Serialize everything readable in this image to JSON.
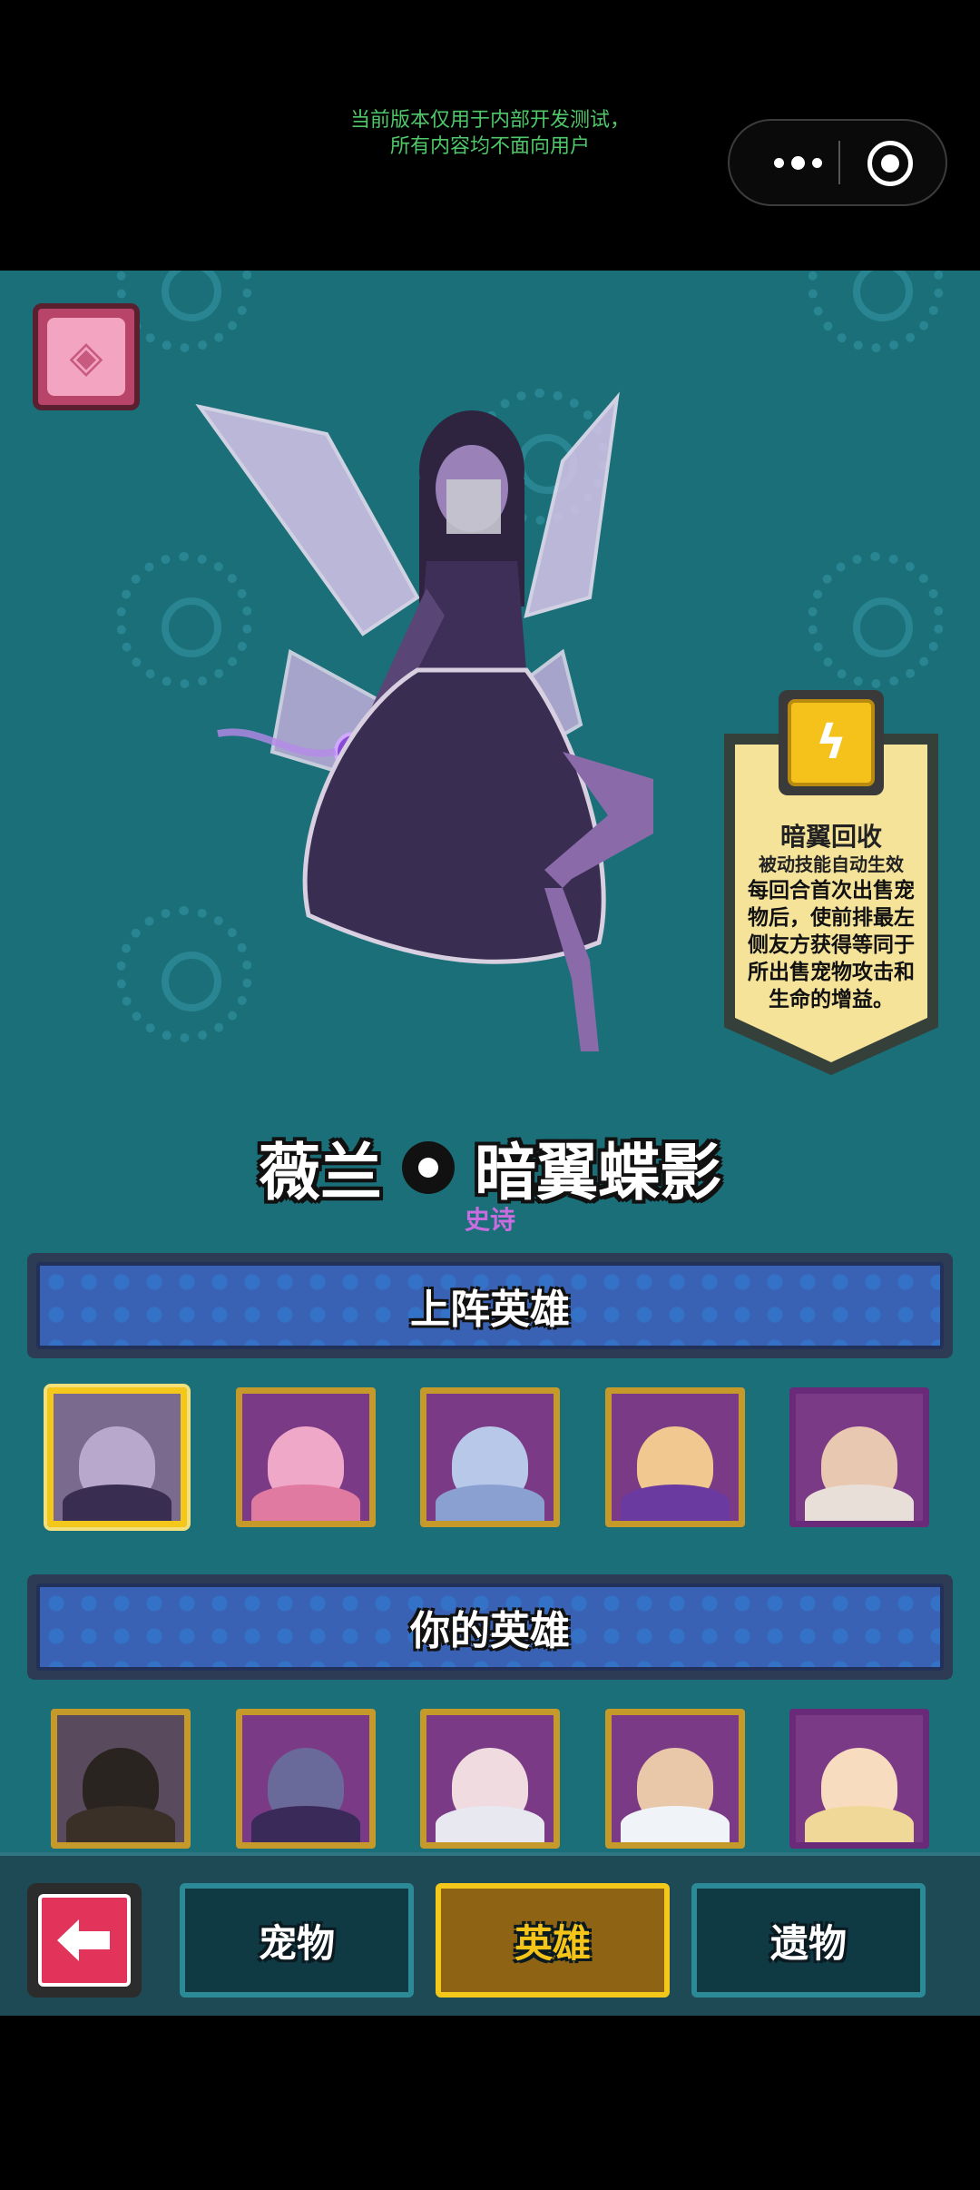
{
  "system": {
    "notice_line1": "当前版本仅用于内部开发测试，",
    "notice_line2": "所有内容均不面向用户",
    "menu_icon": "more-dots-icon",
    "close_icon": "target-circle-icon"
  },
  "hero": {
    "name_part1": "薇兰",
    "name_part2": "暗翼蝶影",
    "rarity": "史诗",
    "rarity_color": "#c86ce0"
  },
  "skill": {
    "icon": "lightning-icon",
    "name": "暗翼回收",
    "type": "被动技能自动生效",
    "description": "每回合首次出售宠物后，使前排最左侧友方获得等同于所出售宠物攻击和生命的增益。"
  },
  "sections": {
    "deployed_title": "上阵英雄",
    "owned_title": "你的英雄"
  },
  "deployed_heroes": [
    {
      "id": "dark-fairy",
      "selected": true
    },
    {
      "id": "pink-knight",
      "selected": false
    },
    {
      "id": "moon-maiden",
      "selected": false
    },
    {
      "id": "butterfly-prince",
      "selected": false
    },
    {
      "id": "horned-lady",
      "selected": false
    }
  ],
  "owned_heroes": [
    {
      "id": "hooded-assassin"
    },
    {
      "id": "moon-sorceress"
    },
    {
      "id": "crowned-priestess"
    },
    {
      "id": "cloud-spirit"
    },
    {
      "id": "fairy-queen"
    }
  ],
  "nav": {
    "back_icon": "arrow-left-icon",
    "tabs": [
      {
        "label": "宠物",
        "active": false
      },
      {
        "label": "英雄",
        "active": true
      },
      {
        "label": "遗物",
        "active": false
      }
    ]
  },
  "colors": {
    "background": "#1a6f78",
    "accent_gold": "#f3c81a",
    "banner_blue": "#3a62b4",
    "back_red": "#e2335a"
  }
}
